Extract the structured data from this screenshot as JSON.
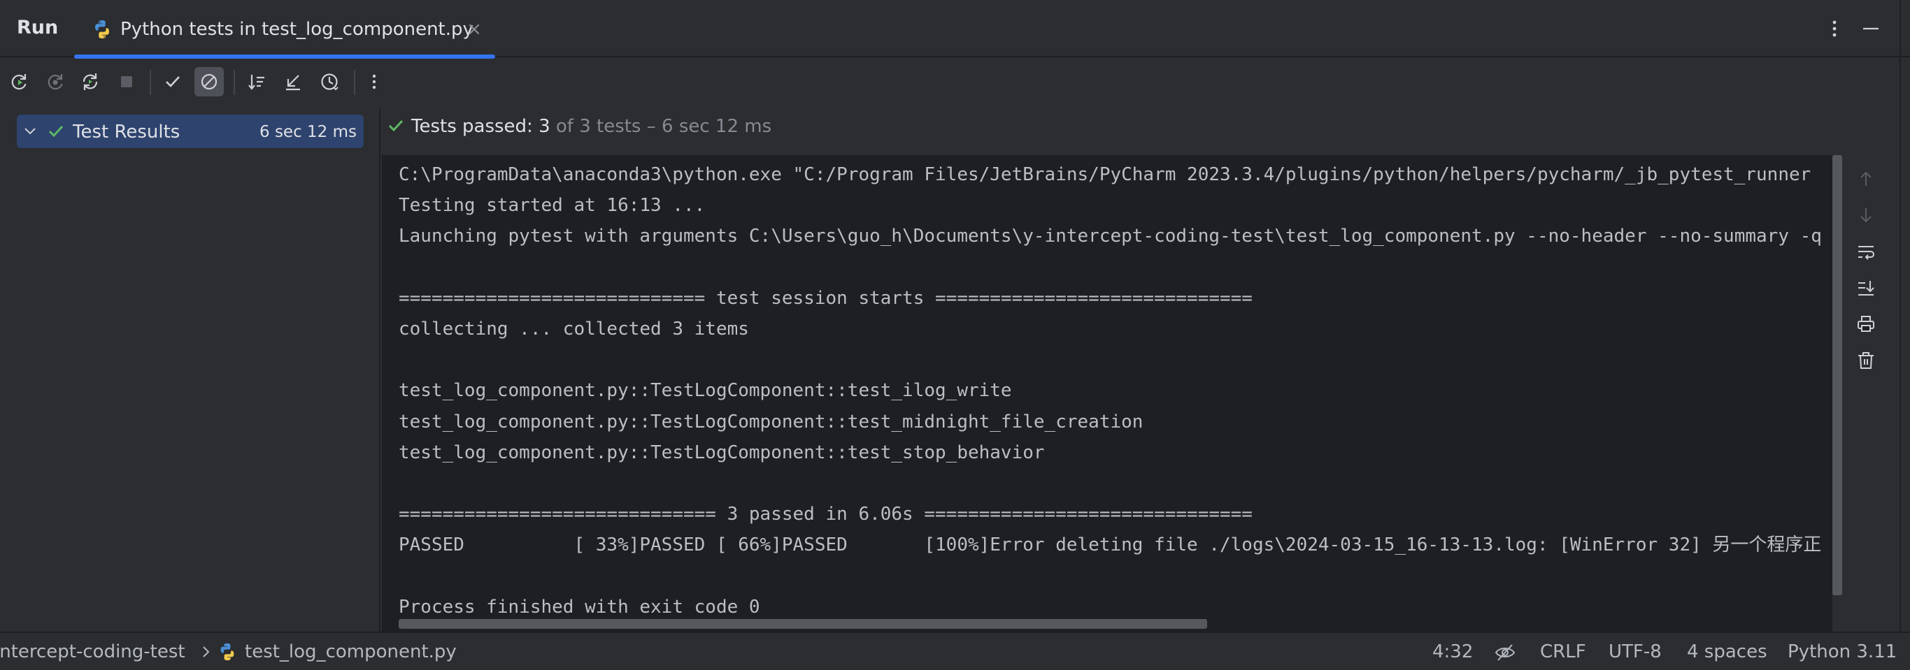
{
  "header": {
    "run_title": "Run",
    "tab_label": "Python tests in test_log_component.py",
    "tab_close": "×"
  },
  "toolbar": {
    "buttons": [
      {
        "name": "rerun-icon",
        "enabled": true
      },
      {
        "name": "rerun-failed-icon",
        "enabled": false
      },
      {
        "name": "toggle-auto-test-icon",
        "enabled": true
      },
      {
        "name": "stop-icon",
        "enabled": false
      },
      {
        "name": "show-passed-icon",
        "enabled": true
      },
      {
        "name": "show-ignored-icon",
        "enabled": true,
        "active": true
      },
      {
        "name": "sort-alphabetically-icon",
        "enabled": true
      },
      {
        "name": "import-tests-icon",
        "enabled": true
      },
      {
        "name": "test-history-icon",
        "enabled": true
      },
      {
        "name": "more-options-icon",
        "enabled": true
      }
    ]
  },
  "tree": {
    "root_label": "Test Results",
    "root_time": "6 sec 12 ms"
  },
  "status": {
    "main": "Tests passed: 3",
    "sub": " of 3 tests – 6 sec 12 ms"
  },
  "console": {
    "lines": [
      "C:\\ProgramData\\anaconda3\\python.exe \"C:/Program Files/JetBrains/PyCharm 2023.3.4/plugins/python/helpers/pycharm/_jb_pytest_runner",
      "Testing started at 16:13 ...",
      "Launching pytest with arguments C:\\Users\\guo_h\\Documents\\y-intercept-coding-test\\test_log_component.py --no-header --no-summary -q",
      "",
      "============================ test session starts =============================",
      "collecting ... collected 3 items",
      "",
      "test_log_component.py::TestLogComponent::test_ilog_write",
      "test_log_component.py::TestLogComponent::test_midnight_file_creation",
      "test_log_component.py::TestLogComponent::test_stop_behavior",
      "",
      "============================= 3 passed in 6.06s ==============================",
      "PASSED          [ 33%]PASSED [ 66%]PASSED       [100%]Error deleting file ./logs\\2024-03-15_16-13-13.log: [WinError 32] 另一个程序正",
      "",
      "Process finished with exit code 0"
    ]
  },
  "statusbar": {
    "project": "intercept-coding-test",
    "file": "test_log_component.py",
    "position": "4:32",
    "line_separator": "CRLF",
    "encoding": "UTF-8",
    "indent": "4 spaces",
    "interpreter": "Python 3.11"
  },
  "colors": {
    "background": "#2b2d30",
    "console_bg": "#1e1f22",
    "accent": "#3574f0",
    "selection": "#2e436e",
    "success": "#5fb865"
  }
}
